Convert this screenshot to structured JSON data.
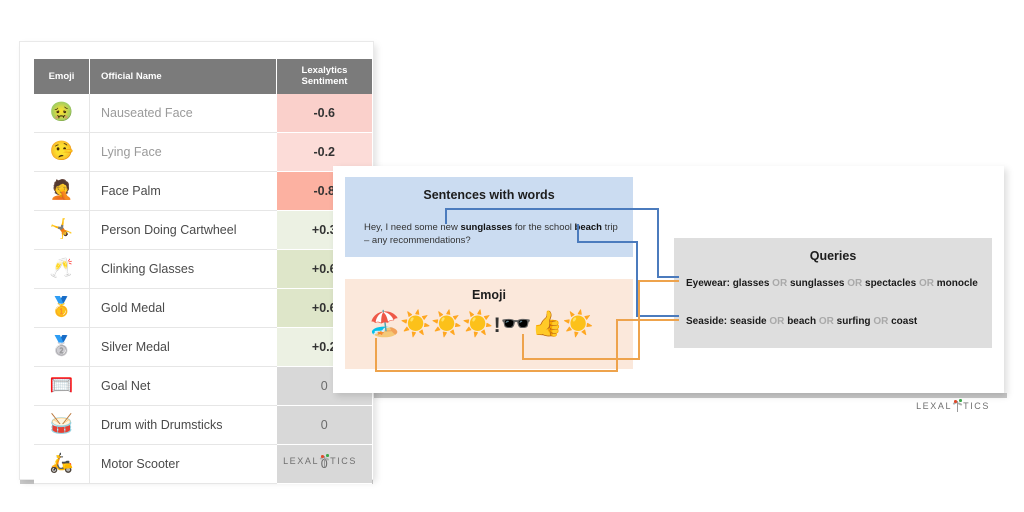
{
  "table_card": {
    "columns": [
      "Emoji",
      "Official Name",
      "Lexalytics\nSentiment"
    ],
    "col_emoji": "Emoji",
    "col_name": "Official Name",
    "col_sent_line1": "Lexalytics",
    "col_sent_line2": "Sentiment",
    "rows": [
      {
        "emoji": "🤢",
        "emoji_name": "nauseated-face-emoji",
        "name": "Nauseated Face",
        "sentiment": "-0.6",
        "color": "#fad0cb"
      },
      {
        "emoji": "🤥",
        "emoji_name": "lying-face-emoji",
        "name": "Lying Face",
        "sentiment": "-0.2",
        "color": "#fcdcd8"
      },
      {
        "emoji": "🤦",
        "emoji_name": "face-palm-emoji",
        "name": "Face Palm",
        "sentiment": "-0.8",
        "color": "#fcb1a1"
      },
      {
        "emoji": "🤸",
        "emoji_name": "person-doing-cartwheel-emoji",
        "name": "Person Doing Cartwheel",
        "sentiment": "+0.3",
        "color": "#ecf1e3"
      },
      {
        "emoji": "🥂",
        "emoji_name": "clinking-glasses-emoji",
        "name": "Clinking Glasses",
        "sentiment": "+0.6",
        "color": "#dee6c9"
      },
      {
        "emoji": "🥇",
        "emoji_name": "gold-medal-emoji",
        "name": "Gold Medal",
        "sentiment": "+0.6",
        "color": "#dee6c9"
      },
      {
        "emoji": "🥈",
        "emoji_name": "silver-medal-emoji",
        "name": "Silver Medal",
        "sentiment": "+0.2",
        "color": "#ecf1e3"
      },
      {
        "emoji": "🥅",
        "emoji_name": "goal-net-emoji",
        "name": "Goal Net",
        "sentiment": "0",
        "color": "#d8d8d8"
      },
      {
        "emoji": "🥁",
        "emoji_name": "drum-with-drumsticks-emoji",
        "name": "Drum with Drumsticks",
        "sentiment": "0",
        "color": "#d8d8d8"
      },
      {
        "emoji": "🛵",
        "emoji_name": "motor-scooter-emoji",
        "name": "Motor Scooter",
        "sentiment": "0",
        "color": "#d8d8d8"
      }
    ],
    "logo_text": "LEXALYTICS"
  },
  "diagram_card": {
    "sentences_panel": {
      "title": "Sentences with words",
      "sentence_part1": "Hey, I need some new ",
      "sentence_bold1": "sunglasses",
      "sentence_part2": " for the school ",
      "sentence_bold2": "beach",
      "sentence_part3": " trip – any recommendations?",
      "bg_color": "#cbdcf1"
    },
    "emoji_panel": {
      "title": "Emoji",
      "emojis": [
        "🏖️",
        "☀️",
        "☀️",
        "☀️"
      ],
      "bang": "!",
      "emojis2": [
        "🕶️",
        "👍",
        "☀️"
      ],
      "bg_color": "#fbe8db"
    },
    "queries_panel": {
      "title": "Queries",
      "bg_color": "#dedede",
      "queries": [
        {
          "label": "Eyewear:",
          "terms": [
            "glasses",
            "sunglasses",
            "spectacles",
            "monocle"
          ],
          "operator": "OR"
        },
        {
          "label": "Seaside:",
          "terms": [
            "seaside",
            "beach",
            "surfing",
            "coast"
          ],
          "operator": "OR"
        }
      ]
    },
    "logo_text": "LEXALYTICS",
    "wire_colors": {
      "words": "#4b7bbd",
      "emoji": "#eea34c"
    }
  }
}
